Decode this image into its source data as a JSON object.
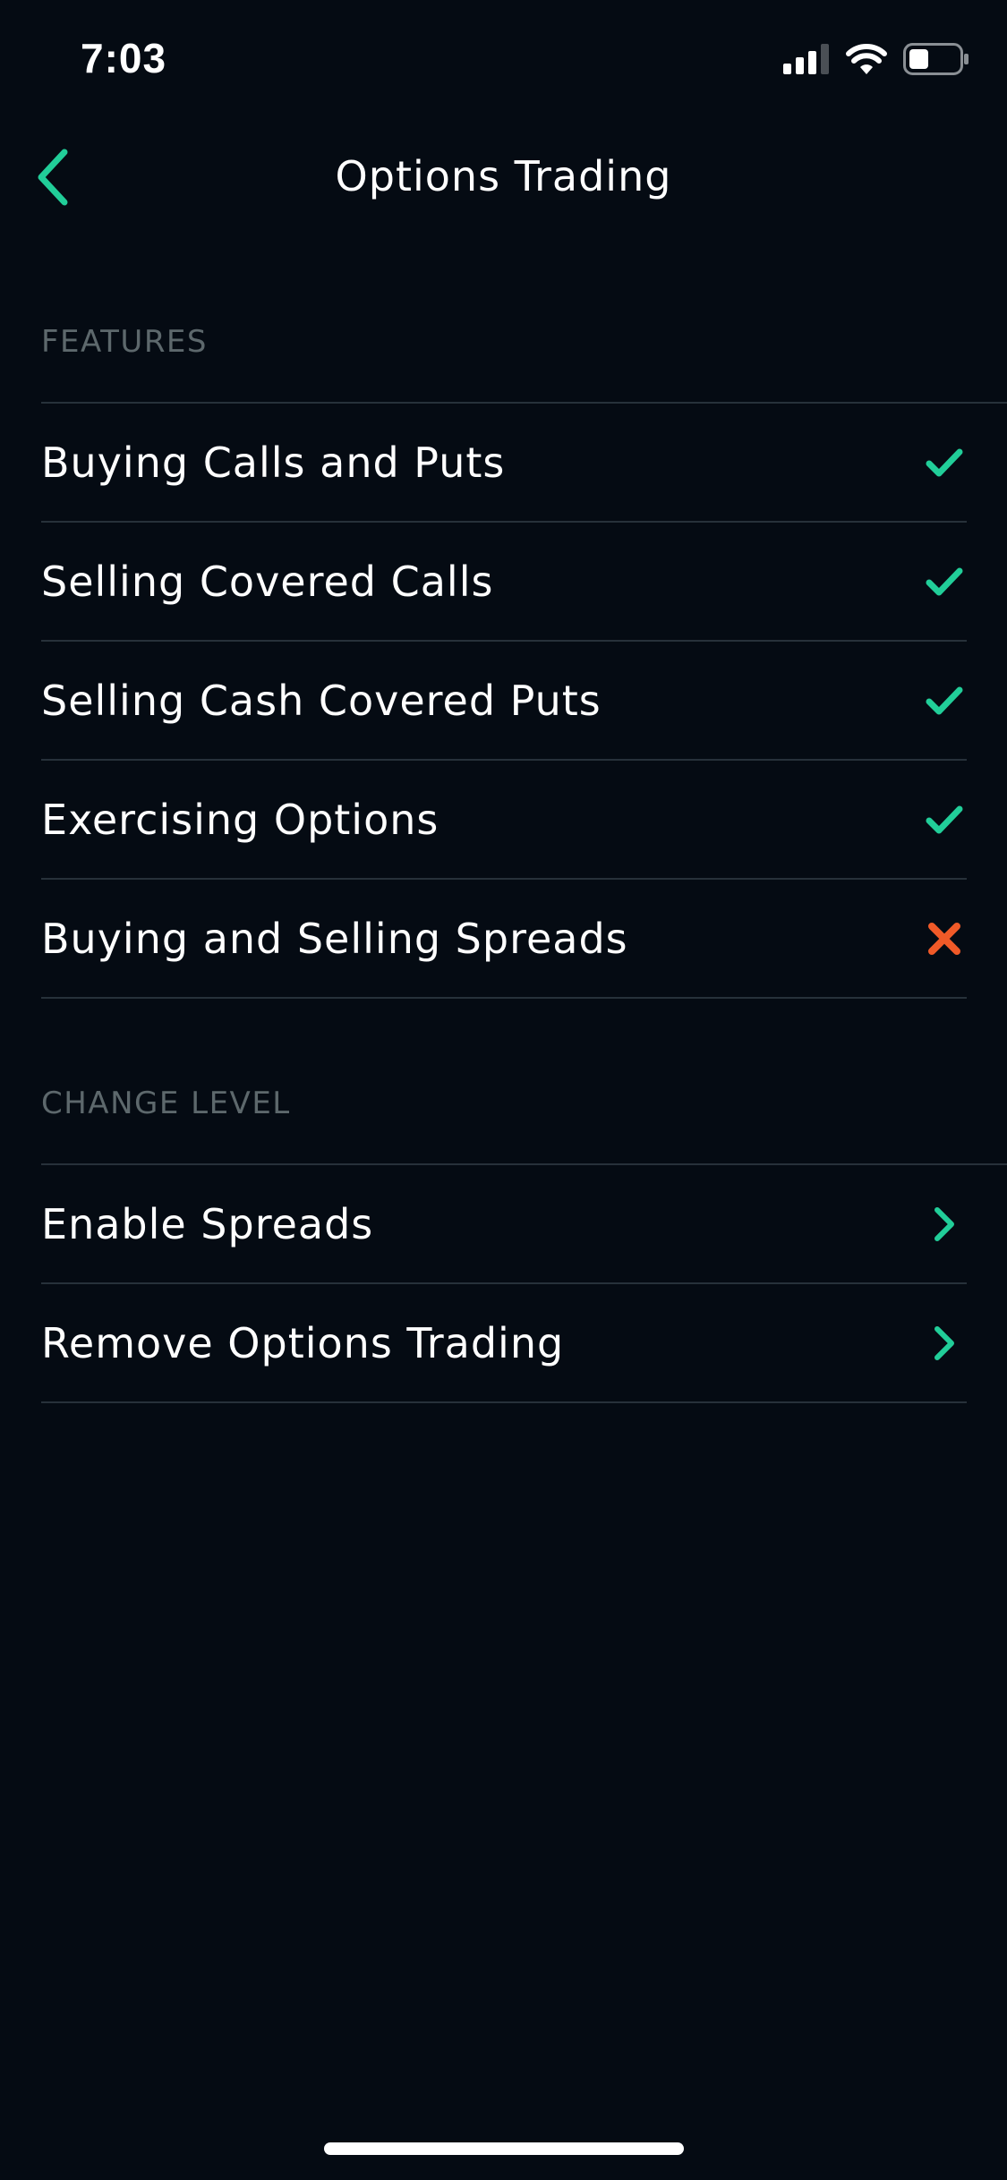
{
  "status_bar": {
    "time": "7:03"
  },
  "nav": {
    "title": "Options Trading"
  },
  "colors": {
    "accent": "#21ce99",
    "negative": "#f05a28",
    "background": "#050b13",
    "section_header": "#5d686c",
    "divider": "#27313a"
  },
  "features": {
    "header": "FEATURES",
    "items": [
      {
        "label": "Buying Calls and Puts",
        "icon": "checkmark-icon",
        "enabled": true
      },
      {
        "label": "Selling Covered Calls",
        "icon": "checkmark-icon",
        "enabled": true
      },
      {
        "label": "Selling Cash Covered Puts",
        "icon": "checkmark-icon",
        "enabled": true
      },
      {
        "label": "Exercising Options",
        "icon": "checkmark-icon",
        "enabled": true
      },
      {
        "label": "Buying and Selling Spreads",
        "icon": "x-mark-icon",
        "enabled": false
      }
    ]
  },
  "change_level": {
    "header": "CHANGE LEVEL",
    "items": [
      {
        "label": "Enable Spreads",
        "icon": "chevron-right-icon"
      },
      {
        "label": "Remove Options Trading",
        "icon": "chevron-right-icon"
      }
    ]
  }
}
